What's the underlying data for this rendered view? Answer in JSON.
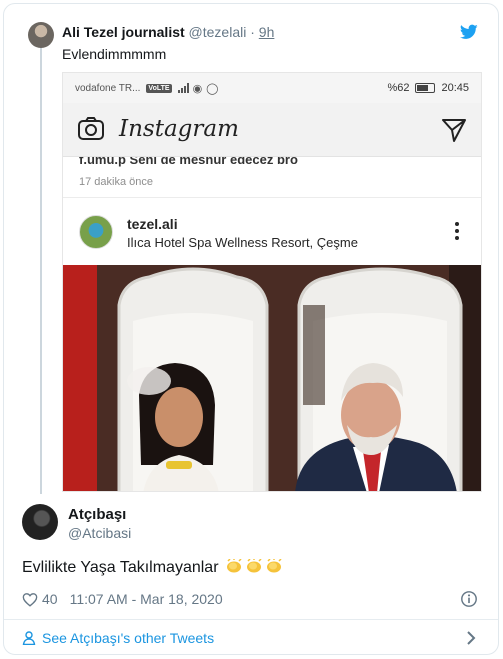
{
  "colors": {
    "twitter_blue": "#1da1f2",
    "link_blue": "#1b95e0",
    "secondary_text": "#657786"
  },
  "quoted_tweet": {
    "name": "Ali Tezel journalist",
    "handle": "@tezelali",
    "separator": "·",
    "time": "9h",
    "text": "Evlendimmmmm"
  },
  "screenshot": {
    "status_bar": {
      "carrier": "vodafone TR...",
      "volte": "VoLTE",
      "battery": "%62",
      "clock": "20:45"
    },
    "app_logo": "Instagram",
    "cut_comment": "f.umu.p Seni de meshur edecez bro",
    "comment_age": "17 dakika önce",
    "post": {
      "username": "tezel.ali",
      "location": "Ilıca Hotel Spa Wellness Resort, Çeşme"
    }
  },
  "tweet": {
    "name": "Atçıbaşı",
    "handle": "@Atcibasi",
    "text": "Evlilikte Yaşa Takılmayanlar",
    "likes": "40",
    "timestamp": "11:07 AM - Mar 18, 2020",
    "see_more": "See Atçıbaşı's other Tweets"
  },
  "icons": {
    "twitter": "twitter-bird-icon",
    "camera": "camera-icon",
    "send": "direct-send-icon",
    "more": "more-vertical-icon",
    "heart": "heart-icon",
    "info": "info-icon",
    "person": "person-icon",
    "chevron": "chevron-right-icon",
    "clap": "clapping-hands-emoji"
  }
}
